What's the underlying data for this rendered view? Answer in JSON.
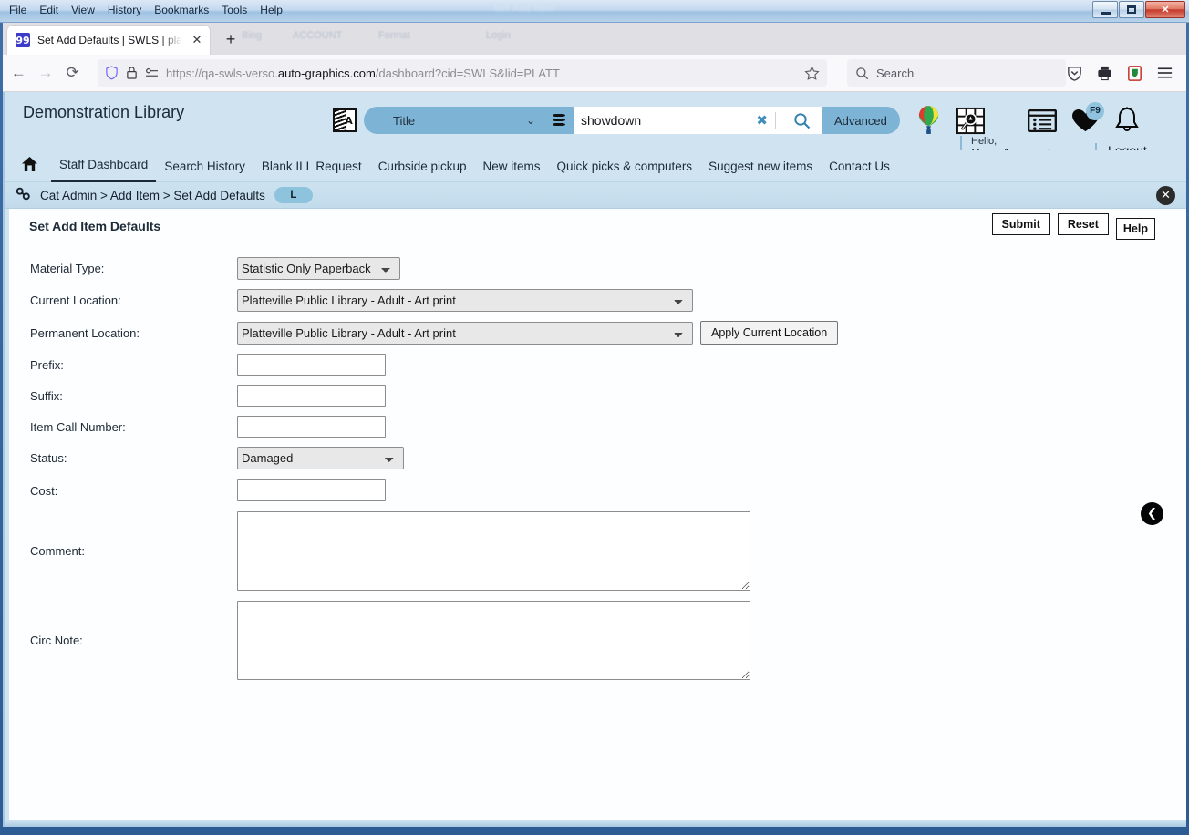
{
  "window": {
    "menus": [
      "File",
      "Edit",
      "View",
      "History",
      "Bookmarks",
      "Tools",
      "Help"
    ],
    "ghost_title": "Set Add Item",
    "minimize_label": "Minimize",
    "maximize_label": "Maximize",
    "close_label": "✕"
  },
  "browser": {
    "tab": {
      "favicon": "swls-favicon",
      "title": "Set Add Defaults | SWLS | platt |",
      "close": "✕"
    },
    "newtab_label": "+",
    "nav": {
      "back": "←",
      "forward": "→",
      "reload": "⟳"
    },
    "url": {
      "prefix": "https://qa-swls-verso.",
      "domain": "auto-graphics.com",
      "suffix": "/dashboard?cid=SWLS&lid=PLATT",
      "bookmark_icon": "star-icon"
    },
    "search": {
      "placeholder": "Search",
      "label": "Search"
    },
    "ghost_bookmarks": [
      "Bing",
      "ACCOUNT",
      "Format",
      "Login"
    ]
  },
  "site": {
    "title": "Demonstration Library",
    "search": {
      "lang_icon": "translate-icon",
      "scope_selected": "Title",
      "database_icon": "database-icon",
      "query": "showdown",
      "clear_label": "✖",
      "search_icon": "magnifier-icon",
      "advanced_label": "Advanced"
    },
    "header_icons": [
      "hot-air-balloon-icon",
      "map-search-icon",
      "list-view-icon",
      "heart-icon",
      "bell-icon"
    ],
    "heart_badge": "F9",
    "account": {
      "greeting": "Hello,",
      "name": "Your Account",
      "chevron": "⌄"
    },
    "logout_label": "Logout",
    "nav_items": [
      {
        "label": "Staff Dashboard",
        "active": true
      },
      {
        "label": "Search History",
        "active": false
      },
      {
        "label": "Blank ILL Request",
        "active": false
      },
      {
        "label": "Curbside pickup",
        "active": false
      },
      {
        "label": "New items",
        "active": false
      },
      {
        "label": "Quick picks & computers",
        "active": false
      },
      {
        "label": "Suggest new items",
        "active": false
      },
      {
        "label": "Contact Us",
        "active": false
      }
    ],
    "breadcrumb": {
      "icon": "link-chain-icon",
      "text": "Cat Admin > Add Item > Set Add Defaults",
      "pill": "L",
      "close": "✕"
    }
  },
  "form": {
    "title": "Set Add Item Defaults",
    "buttons": {
      "submit": "Submit",
      "reset": "Reset",
      "help": "Help"
    },
    "fields": {
      "material_type": {
        "label": "Material Type:",
        "value": "Statistic Only Paperback"
      },
      "current_location": {
        "label": "Current Location:",
        "value": "Platteville Public Library - Adult - Art print"
      },
      "permanent_location": {
        "label": "Permanent Location:",
        "value": "Platteville Public Library - Adult - Art print",
        "apply_button": "Apply Current Location"
      },
      "prefix": {
        "label": "Prefix:",
        "value": ""
      },
      "suffix": {
        "label": "Suffix:",
        "value": ""
      },
      "item_call_number": {
        "label": "Item Call Number:",
        "value": ""
      },
      "status": {
        "label": "Status:",
        "value": "Damaged"
      },
      "cost": {
        "label": "Cost:",
        "value": ""
      },
      "comment": {
        "label": "Comment:",
        "value": ""
      },
      "circ_note": {
        "label": "Circ Note:",
        "value": ""
      }
    },
    "collapse_arrow": "❮"
  },
  "colors": {
    "header_bg": "#cfe3f0",
    "accent": "#7db4d5",
    "pill": "#8ec3de",
    "text": "#1c2a36"
  }
}
